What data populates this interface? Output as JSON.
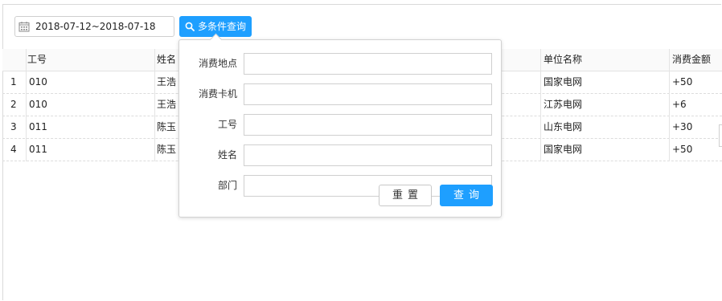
{
  "toolbar": {
    "date_range": "2018-07-12~2018-07-18",
    "search_button_label": "多条件查询"
  },
  "table": {
    "headers": [
      "工号",
      "姓名",
      "单位名称",
      "消费金额"
    ],
    "rows": [
      {
        "index": "1",
        "id": "010",
        "name": "王浩",
        "unit": "国家电网",
        "amount": "+50"
      },
      {
        "index": "2",
        "id": "010",
        "name": "王浩",
        "unit": "江苏电网",
        "amount": "+6"
      },
      {
        "index": "3",
        "id": "011",
        "name": "陈玉",
        "unit": "山东电网",
        "amount": "+30"
      },
      {
        "index": "4",
        "id": "011",
        "name": "陈玉",
        "unit": "国家电网",
        "amount": "+50"
      }
    ]
  },
  "filter_popup": {
    "fields": [
      {
        "label": "消费地点",
        "value": ""
      },
      {
        "label": "消费卡机",
        "value": ""
      },
      {
        "label": "工号",
        "value": ""
      },
      {
        "label": "姓名",
        "value": ""
      },
      {
        "label": "部门",
        "value": ""
      }
    ],
    "reset_label": "重置",
    "query_label": "查询"
  },
  "colors": {
    "accent": "#1e9fff",
    "border": "#d2d2d2"
  },
  "icons": {
    "date": "calendar-icon",
    "search": "search-icon"
  }
}
